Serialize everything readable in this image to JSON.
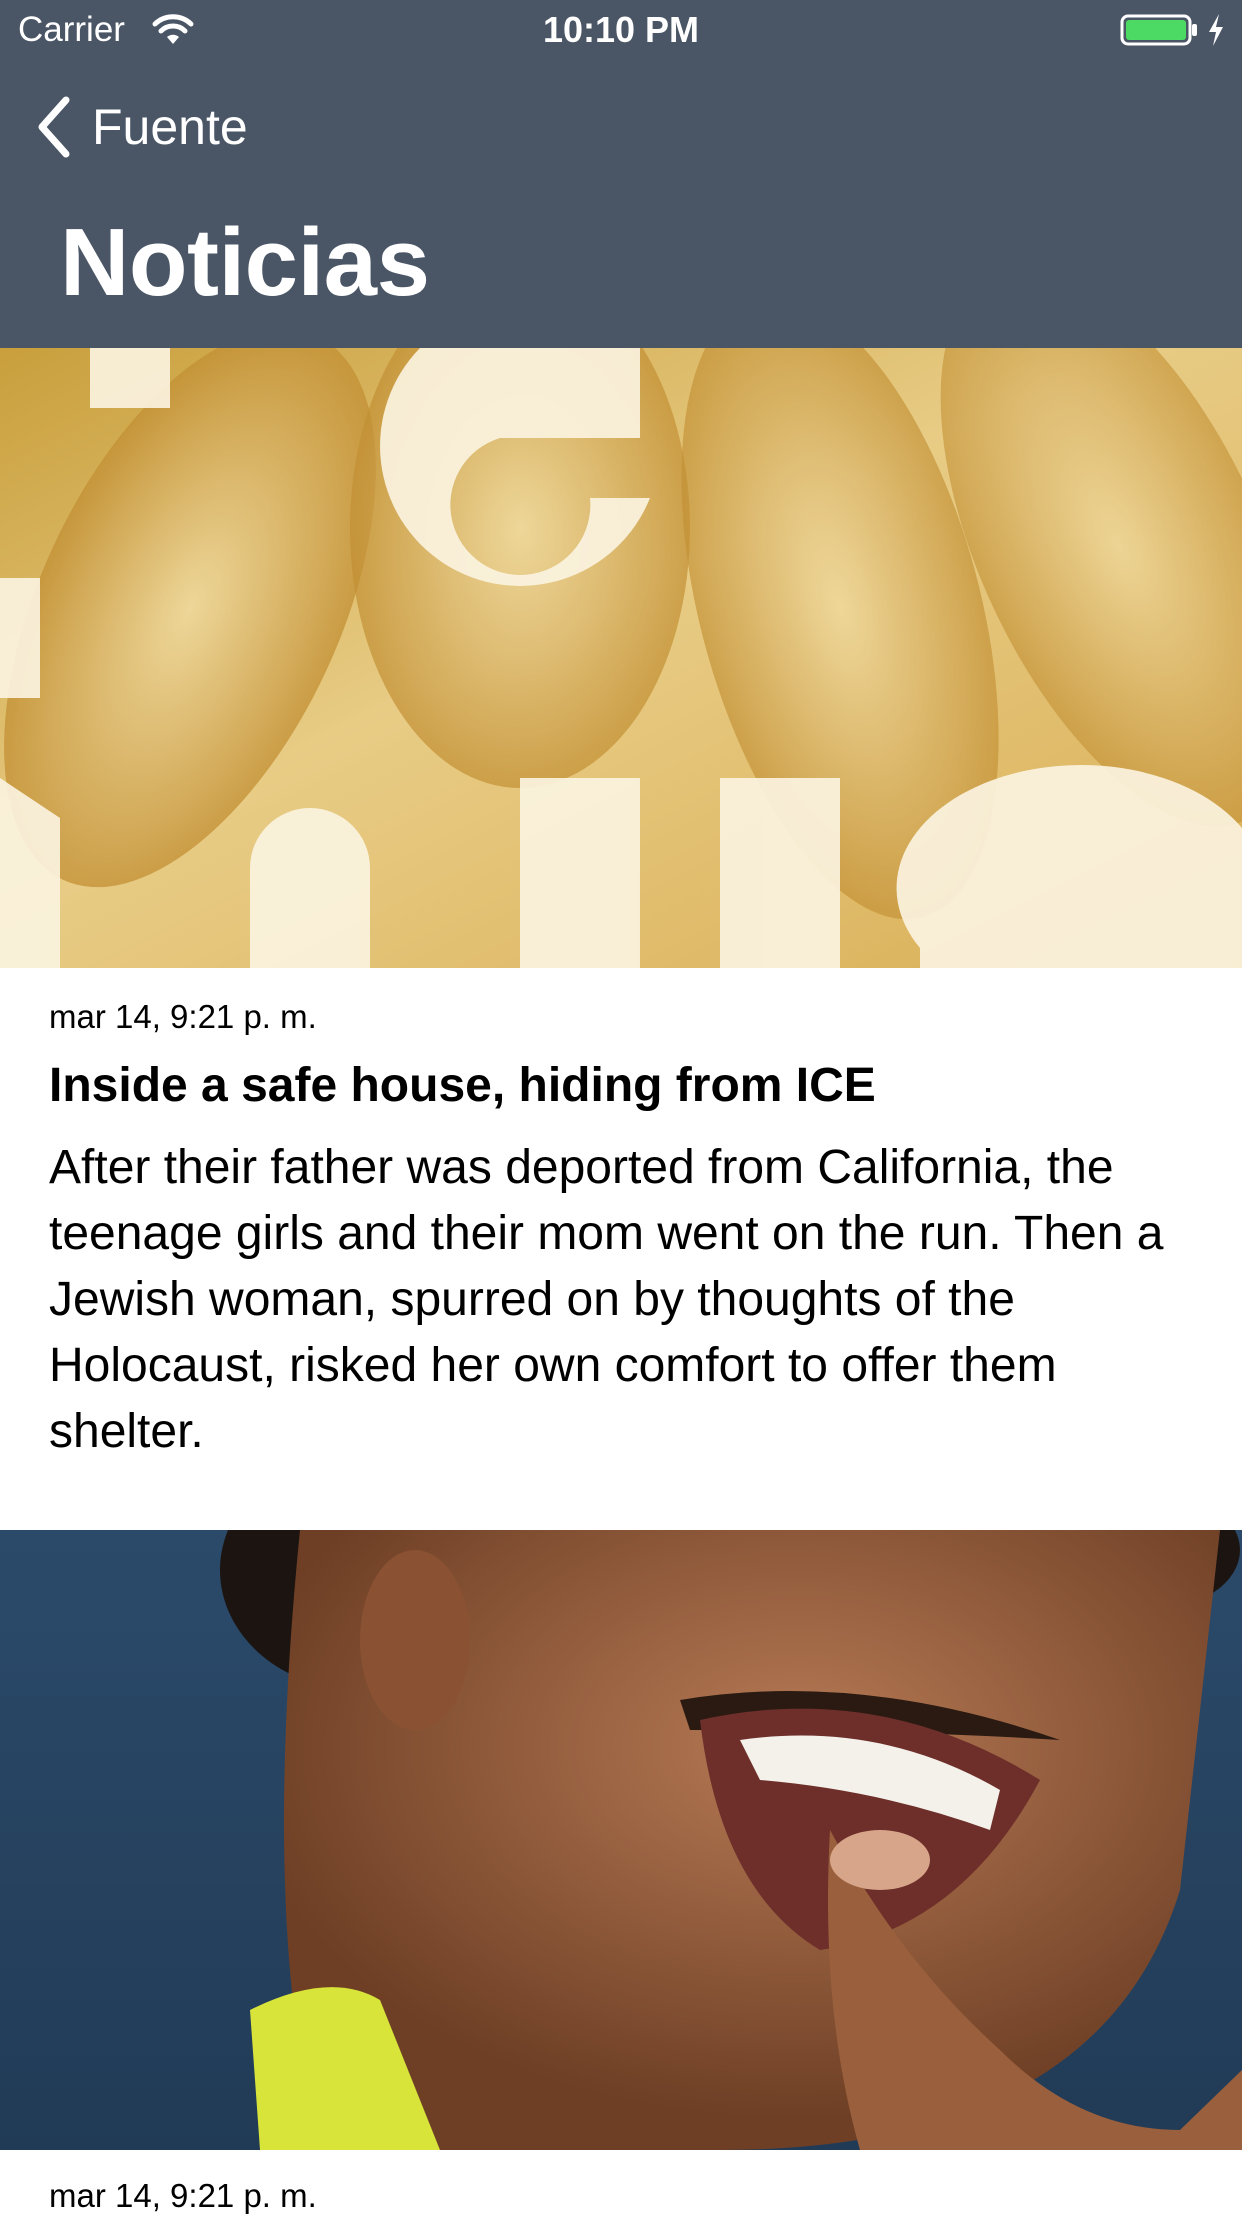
{
  "status_bar": {
    "carrier": "Carrier",
    "time": "10:10 PM",
    "icons": [
      "wifi-icon",
      "battery-icon",
      "charging-icon"
    ]
  },
  "nav": {
    "back_label": "Fuente",
    "back_icon": "chevron-left-icon",
    "title": "Noticias"
  },
  "articles": [
    {
      "date": "mar 14, 9:21 p. m.",
      "headline": "Inside a safe house, hiding from ICE",
      "summary": "After their father was deported from California, the teenage girls and their mom went on the run. Then a Jewish woman, spurred on by thoughts of the Holocaust, risked her own comfort to offer them shelter."
    },
    {
      "date": "mar 14, 9:21 p. m."
    }
  ],
  "colors": {
    "nav_background": "#4a5666",
    "nav_text": "#ffffff",
    "battery_fill": "#4cd964"
  }
}
